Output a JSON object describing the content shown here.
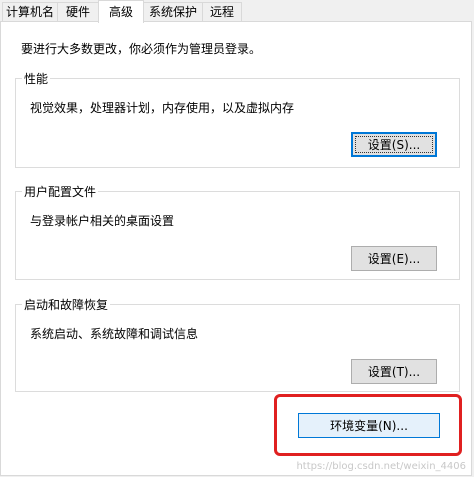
{
  "tabs": [
    {
      "label": "计算机名"
    },
    {
      "label": "硬件"
    },
    {
      "label": "高级"
    },
    {
      "label": "系统保护"
    },
    {
      "label": "远程"
    }
  ],
  "admin_note": "要进行大多数更改，你必须作为管理员登录。",
  "groups": {
    "performance": {
      "title": "性能",
      "description": "视觉效果，处理器计划，内存使用，以及虚拟内存",
      "button": "设置(S)..."
    },
    "user_profiles": {
      "title": "用户配置文件",
      "description": "与登录帐户相关的桌面设置",
      "button": "设置(E)..."
    },
    "startup_recovery": {
      "title": "启动和故障恢复",
      "description": "系统启动、系统故障和调试信息",
      "button": "设置(T)..."
    }
  },
  "env_button": "环境变量(N)...",
  "watermark": "https://blog.csdn.net/weixin_4406",
  "colors": {
    "highlight": "#e02020",
    "focus": "#0078d7"
  }
}
